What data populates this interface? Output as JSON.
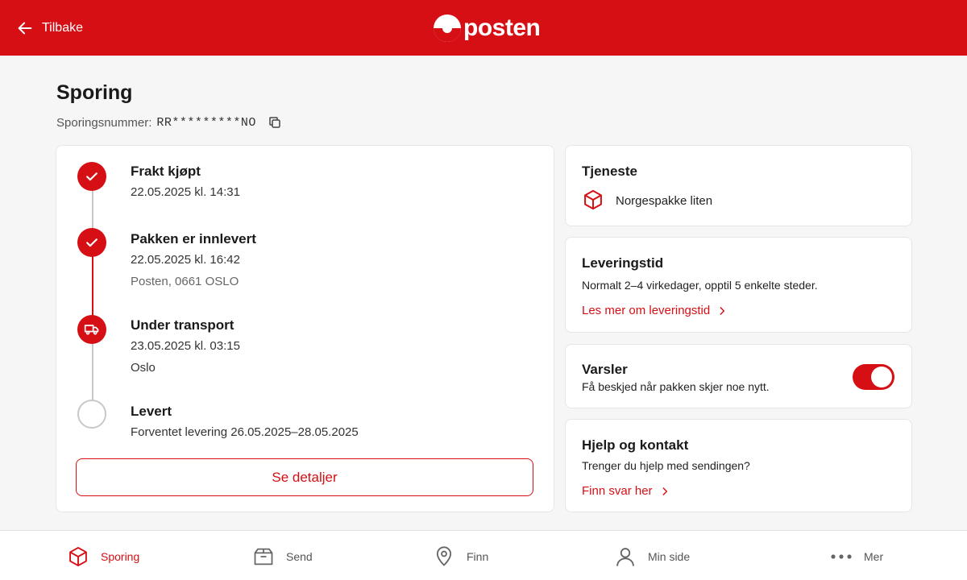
{
  "header": {
    "back_label": "Tilbake",
    "logo_text": "posten",
    "brand_color": "#d50f14"
  },
  "page": {
    "title": "Sporing",
    "tracking_label": "Sporingsnummer:",
    "tracking_number": "RR*********NO"
  },
  "timeline": {
    "steps": [
      {
        "title": "Frakt kjøpt",
        "lines": [
          "22.05.2025 kl. 14:31"
        ],
        "status": "done",
        "icon": "check-icon"
      },
      {
        "title": "Pakken er innlevert",
        "lines": [
          "22.05.2025 kl. 16:42",
          "Posten, 0661 OSLO"
        ],
        "status": "done",
        "icon": "check-icon"
      },
      {
        "title": "Under transport",
        "lines": [
          "23.05.2025 kl. 03:15",
          "Oslo"
        ],
        "status": "current",
        "icon": "truck-icon"
      },
      {
        "title": "Levert",
        "lines": [
          "Forventet levering 26.05.2025–28.05.2025"
        ],
        "status": "pending",
        "icon": "empty-circle-icon"
      }
    ],
    "details_button": "Se detaljer"
  },
  "service": {
    "heading": "Tjeneste",
    "name": "Norgespakke liten",
    "icon": "package-icon"
  },
  "delivery": {
    "heading": "Leveringstid",
    "text": "Normalt 2–4 virkedager, opptil 5 enkelte steder.",
    "link": "Les mer om leveringstid"
  },
  "notifications": {
    "heading": "Varsler",
    "text": "Få beskjed når pakken skjer noe nytt.",
    "enabled": true
  },
  "help": {
    "heading": "Hjelp og kontakt",
    "text": "Trenger du hjelp med sendingen?",
    "link": "Finn svar her"
  },
  "nav": {
    "items": [
      {
        "label": "Sporing",
        "icon": "package-icon",
        "active": true
      },
      {
        "label": "Send",
        "icon": "box-icon",
        "active": false
      },
      {
        "label": "Finn",
        "icon": "location-pin-icon",
        "active": false
      },
      {
        "label": "Min side",
        "icon": "user-icon",
        "active": false
      },
      {
        "label": "Mer",
        "icon": "more-dots-icon",
        "active": false
      }
    ]
  }
}
